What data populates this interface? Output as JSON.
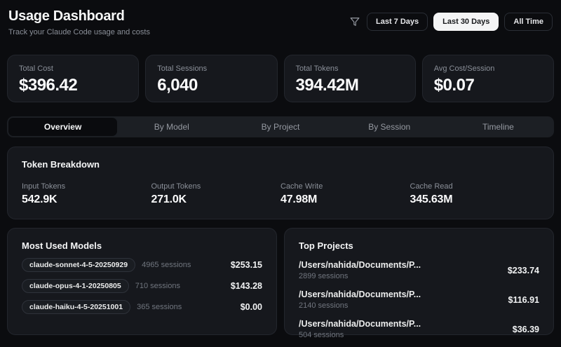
{
  "colors": {
    "page_bg": "#0b0c0f",
    "card_bg": "#16181d",
    "card_border": "#23262d",
    "active_button_bg": "#f4f4f5",
    "muted_text": "#8a8f98"
  },
  "header": {
    "title": "Usage Dashboard",
    "subtitle": "Track your Claude Code usage and costs"
  },
  "filters": {
    "icon": "funnel-icon",
    "buttons": [
      {
        "label": "Last 7 Days",
        "active": false
      },
      {
        "label": "Last 30 Days",
        "active": true
      },
      {
        "label": "All Time",
        "active": false
      }
    ]
  },
  "stats": [
    {
      "label": "Total Cost",
      "value": "$396.42"
    },
    {
      "label": "Total Sessions",
      "value": "6,040"
    },
    {
      "label": "Total Tokens",
      "value": "394.42M"
    },
    {
      "label": "Avg Cost/Session",
      "value": "$0.07"
    }
  ],
  "tabs": [
    {
      "label": "Overview",
      "active": true
    },
    {
      "label": "By Model",
      "active": false
    },
    {
      "label": "By Project",
      "active": false
    },
    {
      "label": "By Session",
      "active": false
    },
    {
      "label": "Timeline",
      "active": false
    }
  ],
  "token_breakdown": {
    "title": "Token Breakdown",
    "items": [
      {
        "label": "Input Tokens",
        "value": "542.9K"
      },
      {
        "label": "Output Tokens",
        "value": "271.0K"
      },
      {
        "label": "Cache Write",
        "value": "47.98M"
      },
      {
        "label": "Cache Read",
        "value": "345.63M"
      }
    ]
  },
  "most_used_models": {
    "title": "Most Used Models",
    "rows": [
      {
        "model": "claude-sonnet-4-5-20250929",
        "sessions": "4965 sessions",
        "cost": "$253.15"
      },
      {
        "model": "claude-opus-4-1-20250805",
        "sessions": "710 sessions",
        "cost": "$143.28"
      },
      {
        "model": "claude-haiku-4-5-20251001",
        "sessions": "365 sessions",
        "cost": "$0.00"
      }
    ]
  },
  "top_projects": {
    "title": "Top Projects",
    "rows": [
      {
        "path": "/Users/nahida/Documents/P...",
        "sessions": "2899 sessions",
        "cost": "$233.74"
      },
      {
        "path": "/Users/nahida/Documents/P...",
        "sessions": "2140 sessions",
        "cost": "$116.91"
      },
      {
        "path": "/Users/nahida/Documents/P...",
        "sessions": "504 sessions",
        "cost": "$36.39"
      }
    ]
  }
}
